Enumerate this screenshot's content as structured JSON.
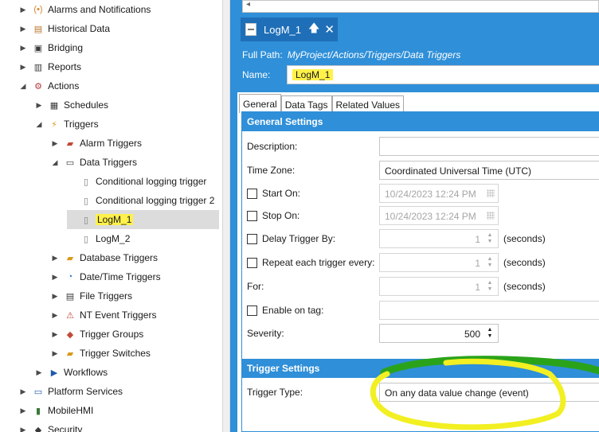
{
  "tree": {
    "items": [
      {
        "label": "Alarms and Notifications",
        "indent": 0,
        "expanded": false,
        "icon": "alarm-icon"
      },
      {
        "label": "Historical Data",
        "indent": 0,
        "expanded": false,
        "icon": "historical-data-icon"
      },
      {
        "label": "Bridging",
        "indent": 0,
        "expanded": false,
        "icon": "bridging-icon"
      },
      {
        "label": "Reports",
        "indent": 0,
        "expanded": false,
        "icon": "reports-icon"
      },
      {
        "label": "Actions",
        "indent": 0,
        "expanded": true,
        "icon": "actions-icon"
      },
      {
        "label": "Schedules",
        "indent": 1,
        "expanded": false,
        "icon": "schedules-icon"
      },
      {
        "label": "Triggers",
        "indent": 1,
        "expanded": true,
        "icon": "lightning-icon"
      },
      {
        "label": "Alarm Triggers",
        "indent": 2,
        "expanded": false,
        "icon": "alarm-trigger-icon"
      },
      {
        "label": "Data Triggers",
        "indent": 2,
        "expanded": true,
        "icon": "data-trigger-icon"
      },
      {
        "label": "Conditional logging trigger",
        "indent": 3,
        "icon": "document-icon"
      },
      {
        "label": "Conditional logging trigger 2",
        "indent": 3,
        "icon": "document-icon"
      },
      {
        "label": "LogM_1",
        "indent": 3,
        "icon": "document-icon",
        "selected": true
      },
      {
        "label": "LogM_2",
        "indent": 3,
        "icon": "document-icon"
      },
      {
        "label": "Database Triggers",
        "indent": 2,
        "expanded": false,
        "icon": "database-trigger-icon"
      },
      {
        "label": "Date/Time Triggers",
        "indent": 2,
        "expanded": false,
        "icon": "clock-icon"
      },
      {
        "label": "File Triggers",
        "indent": 2,
        "expanded": false,
        "icon": "file-trigger-icon"
      },
      {
        "label": "NT Event Triggers",
        "indent": 2,
        "expanded": false,
        "icon": "warning-icon"
      },
      {
        "label": "Trigger Groups",
        "indent": 2,
        "expanded": false,
        "icon": "trigger-groups-icon"
      },
      {
        "label": "Trigger Switches",
        "indent": 2,
        "expanded": false,
        "icon": "trigger-switch-icon"
      },
      {
        "label": "Workflows",
        "indent": 1,
        "expanded": false,
        "icon": "workflow-icon"
      },
      {
        "label": "Platform Services",
        "indent": 0,
        "expanded": false,
        "icon": "monitor-icon"
      },
      {
        "label": "MobileHMI",
        "indent": 0,
        "expanded": false,
        "icon": "mobile-icon"
      },
      {
        "label": "Security",
        "indent": 0,
        "expanded": false,
        "icon": "security-icon"
      }
    ]
  },
  "doc_tab": {
    "title": "LogM_1"
  },
  "header": {
    "full_path_label": "Full Path:",
    "full_path_value": "MyProject/Actions/Triggers/Data Triggers",
    "name_label": "Name:",
    "name_value": "LogM_1"
  },
  "tabs": [
    {
      "label": "General",
      "active": true
    },
    {
      "label": "Data Tags",
      "active": false
    },
    {
      "label": "Related Values",
      "active": false
    }
  ],
  "general_settings": {
    "title": "General Settings",
    "description_label": "Description:",
    "description_value": "",
    "timezone_label": "Time Zone:",
    "timezone_value": "Coordinated Universal Time (UTC)",
    "start_on_label": "Start On:",
    "start_on_value": "10/24/2023 12:24 PM",
    "stop_on_label": "Stop On:",
    "stop_on_value": "10/24/2023 12:24 PM",
    "delay_label": "Delay Trigger By:",
    "delay_value": "1",
    "repeat_label": "Repeat each trigger every:",
    "repeat_value": "1",
    "for_label": "For:",
    "for_value": "1",
    "seconds_unit": "(seconds)",
    "enable_tag_label": "Enable on tag:",
    "severity_label": "Severity:",
    "severity_value": "500"
  },
  "trigger_settings": {
    "title": "Trigger Settings",
    "type_label": "Trigger Type:",
    "type_value": "On any data value change (event)"
  },
  "colors": {
    "accent": "#2f8fd8",
    "tab_active": "#1f6fb8",
    "highlight": "#fff14a",
    "annotation_yellow": "#f2ef22",
    "annotation_green": "#2aa31a"
  }
}
